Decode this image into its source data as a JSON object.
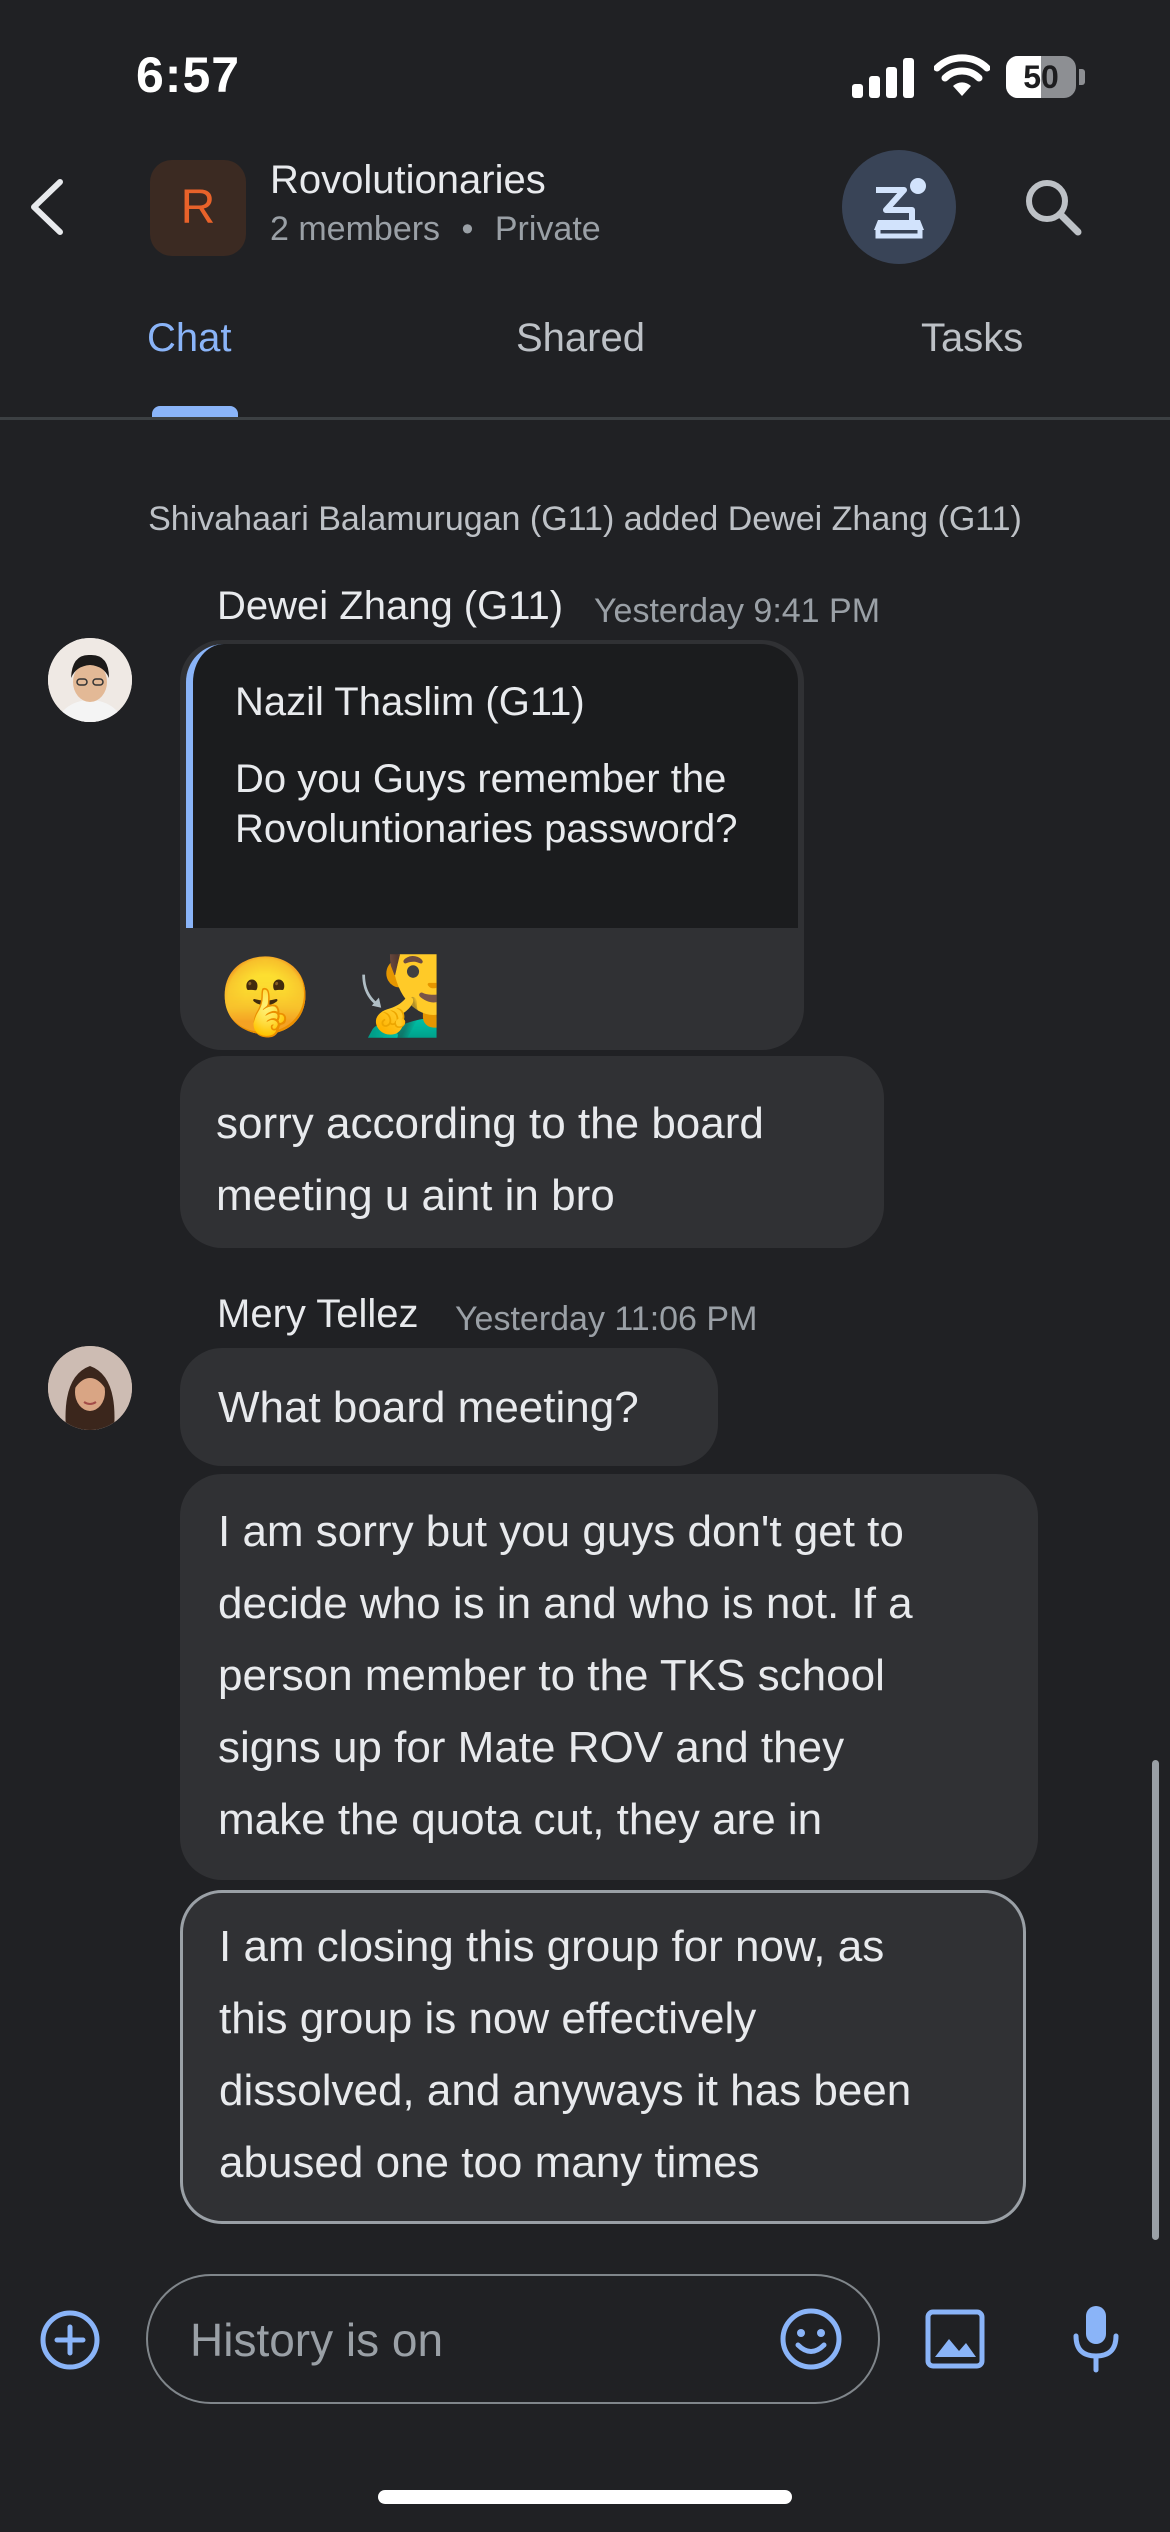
{
  "status_bar": {
    "time": "6:57",
    "battery_level": "50",
    "battery_fraction": 0.5,
    "icons": [
      "cellular-signal-icon",
      "wifi-icon",
      "battery-icon"
    ]
  },
  "header": {
    "back_icon": "chevron-left-icon",
    "room_avatar_letter": "R",
    "room_avatar_color": "#e8622a",
    "room_name": "Rovolutionaries",
    "member_count": "2 members",
    "separator": "•",
    "visibility": "Private",
    "bot_icon": "app-bot-icon",
    "search_icon": "search-icon"
  },
  "tabs": [
    {
      "label": "Chat",
      "active": true
    },
    {
      "label": "Shared",
      "active": false
    },
    {
      "label": "Tasks",
      "active": false
    }
  ],
  "accent_color": "#8ab4f8",
  "system_message": "Shivahaari Balamurugan (G11) added Dewei Zhang (G11)",
  "messages": {
    "dewei": {
      "sender": "Dewei Zhang (G11)",
      "timestamp": "Yesterday 9:41 PM",
      "quote": {
        "sender": "Nazil Thaslim (G11)",
        "text": "Do you Guys remember the Rovoluntionaries password?"
      },
      "reaction_emojis": [
        "🤫",
        "🧏‍♂️"
      ],
      "followup_lines": [
        "sorry according to the board",
        "meeting u aint in bro"
      ]
    },
    "mery": {
      "sender": "Mery Tellez",
      "timestamp": "Yesterday 11:06 PM",
      "message_1": "What board meeting?",
      "message_2_lines": [
        "I am sorry but you guys don't get to",
        "decide who is in and who is not.  If a",
        "person member to the TKS school",
        "signs up for Mate ROV and they",
        "make the quota cut, they are in"
      ],
      "message_3_lines": [
        "I am closing this group for now, as",
        "this group is now effectively",
        "dissolved, and anyways it has been",
        "abused one too many times"
      ]
    }
  },
  "composer": {
    "placeholder": "History is on",
    "add_icon": "add-circle-icon",
    "emoji_icon": "emoji-icon",
    "image_icon": "image-icon",
    "mic_icon": "microphone-icon"
  }
}
